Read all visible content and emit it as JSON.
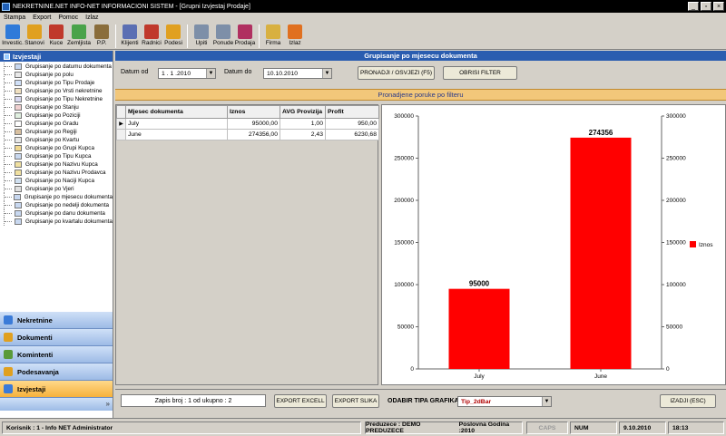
{
  "window": {
    "title": "NEKRETNINE.NET    INFO-NET INFORMACIONI SISTEM - [Grupni Izvjestaj Prodaje]"
  },
  "menu": [
    "Stampa",
    "Export",
    "Pomoc",
    "Izlaz"
  ],
  "toolbar": [
    {
      "label": "Investic.",
      "icon": "house-icon",
      "color": "#2f7ad9"
    },
    {
      "label": "Stanovi",
      "icon": "globe-icon",
      "color": "#e0a020"
    },
    {
      "label": "Kuce",
      "icon": "house-icon",
      "color": "#c0392b"
    },
    {
      "label": "Zemljista",
      "icon": "globe-icon",
      "color": "#4aa34a"
    },
    {
      "label": "P.P.",
      "icon": "building-icon",
      "color": "#8a6d3b"
    },
    {
      "label": "Klijenti",
      "icon": "list-icon",
      "color": "#5b6fb3"
    },
    {
      "label": "Radnici",
      "icon": "people-icon",
      "color": "#c0392b"
    },
    {
      "label": "Podesi",
      "icon": "folder-icon",
      "color": "#e0a020"
    },
    {
      "label": "Upiti",
      "icon": "document-icon",
      "color": "#7d8fa8"
    },
    {
      "label": "Ponude",
      "icon": "document-icon",
      "color": "#7d8fa8"
    },
    {
      "label": "Prodaja",
      "icon": "document-icon",
      "color": "#b03060"
    },
    {
      "label": "Firma",
      "icon": "book-icon",
      "color": "#d8b040"
    },
    {
      "label": "Izlaz",
      "icon": "exit-arrow-icon",
      "color": "#e07020"
    }
  ],
  "left": {
    "title": "Izvjestaji",
    "tree": [
      "Grupisanje po datumu dokumenta",
      "Grupisanje po polu",
      "Grupisanje po Tipu Prodaje",
      "Grupisanje po Vrsti nekretnine",
      "Grupisanje po Tipu Nekretnine",
      "Grupisanje po Stanju",
      "Grupisanje po Poziciji",
      "Grupisanje po Gradu",
      "Grupisanje po Regiji",
      "Grupisanje po Kvartu",
      "Grupisanje po Grupi Kupca",
      "Grupisanje po Tipu Kupca",
      "Grupisanje po Nazivu Kupca",
      "Grupisanje po Nazivu Prodavca",
      "Grupisanje po Naciji Kupca",
      "Grupisanje po Vjeri",
      "Grupisanje po mjesecu dokumenta",
      "Grupisanje po nedelji dokumenta",
      "Grupisanje po danu dokumenta",
      "Grupisanje po kvartalu dokumenta"
    ],
    "nav": [
      {
        "label": "Nekretnine",
        "color": "#3b7bd8"
      },
      {
        "label": "Dokumenti",
        "color": "#e0a020"
      },
      {
        "label": "Komintenti",
        "color": "#5a9a3a"
      },
      {
        "label": "Podesavanja",
        "color": "#e0a020"
      },
      {
        "label": "Izvjestaji",
        "color": "#3b7bd8"
      }
    ],
    "footer_glyph": "»"
  },
  "main": {
    "title": "Grupisanje po mjesecu dokumenta",
    "date_from_label": "Datum od",
    "date_from": "1 . 1 .2010",
    "date_to_label": "Datum do",
    "date_to": "10.10.2010",
    "find_button": "PRONADJI / OSVJEZI (F5)",
    "clear_button": "OBRISI FILTER",
    "result_text": "Pronadjene poruke po filteru",
    "grid": {
      "columns": [
        "Mjesec dokumenta",
        "Iznos",
        "AVG Provizija",
        "Profit"
      ],
      "rows": [
        {
          "marker": "▶",
          "cells": [
            "July",
            "95000,00",
            "1,00",
            "950,00"
          ]
        },
        {
          "marker": "",
          "cells": [
            "June",
            "274356,00",
            "2,43",
            "6230,68"
          ]
        }
      ]
    },
    "record_info": "Zapis broj : 1 od ukupno : 2",
    "export_excel": "EXPORT EXCELL",
    "export_image": "EXPORT SLIKA",
    "chart_type_label": "ODABIR TIPA GRAFIKA",
    "chart_type": "Tip_2dBar",
    "exit_button": "IZADJI (ESC)"
  },
  "chart_data": {
    "type": "bar",
    "categories": [
      "July",
      "June"
    ],
    "series": [
      {
        "name": "Iznos",
        "values": [
          95000,
          274356
        ]
      }
    ],
    "value_labels": [
      "95000",
      "274356"
    ],
    "ylim": [
      0,
      300000
    ],
    "yticks": [
      "0",
      "50000",
      "100000",
      "150000",
      "200000",
      "250000",
      "300000"
    ],
    "secondary_axis": true,
    "grid": false,
    "legend": "right",
    "bar_color": "#ff0000"
  },
  "status": {
    "user": "Korisnik : 1 - Info NET  Administrator",
    "company": "Preduzece : DEMO PREDUZECE",
    "year": "Poslovna Godina :2010",
    "caps": "CAPS",
    "num": "NUM",
    "date": "9.10.2010",
    "time": "18:13"
  }
}
